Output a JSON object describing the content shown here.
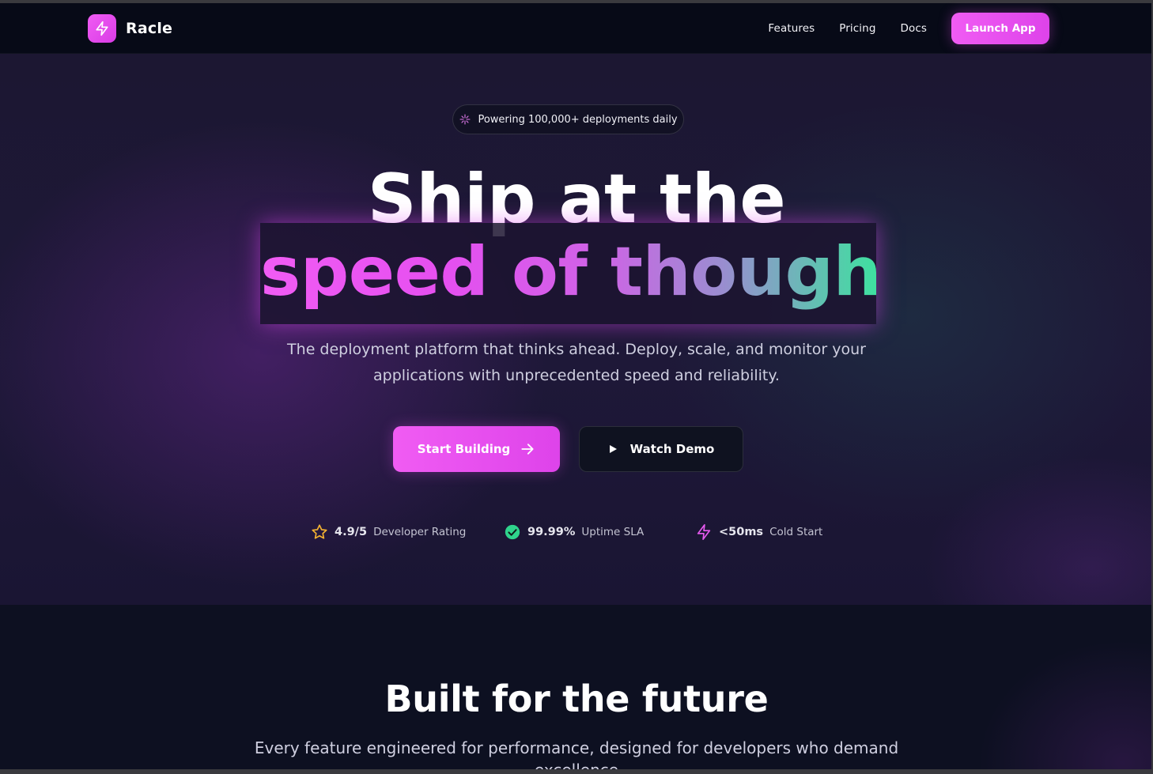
{
  "brand": {
    "name": "Racle",
    "logo_icon": "lightning-icon",
    "accent_color": "#f05cf3"
  },
  "nav": {
    "links": [
      "Features",
      "Pricing",
      "Docs"
    ],
    "cta": "Launch App"
  },
  "hero": {
    "badge_icon": "sparkles-icon",
    "badge_text": "Powering 100,000+ deployments daily",
    "headline_line1": "Ship at the",
    "headline_line2": "speed of thought",
    "subtitle_line1": "The deployment platform that thinks ahead. Deploy, scale, and monitor your",
    "subtitle_line2": "applications with unprecedented speed and reliability.",
    "primary_button": "Start Building",
    "primary_button_icon": "arrow-right-icon",
    "secondary_button": "Watch Demo",
    "secondary_button_icon": "play-icon"
  },
  "stats": [
    {
      "icon": "star-icon",
      "value": "4.9/5",
      "label": "Developer Rating",
      "color": "#f5b331"
    },
    {
      "icon": "check-circle-icon",
      "value": "99.99%",
      "label": "Uptime SLA",
      "color": "#2fd38c"
    },
    {
      "icon": "lightning-icon",
      "value": "<50ms",
      "label": "Cold Start",
      "color": "#e85af0"
    }
  ],
  "features": {
    "title": "Built for the future",
    "subtitle_line1": "Every feature engineered for performance, designed for developers who demand",
    "subtitle_line2": "excellence"
  }
}
